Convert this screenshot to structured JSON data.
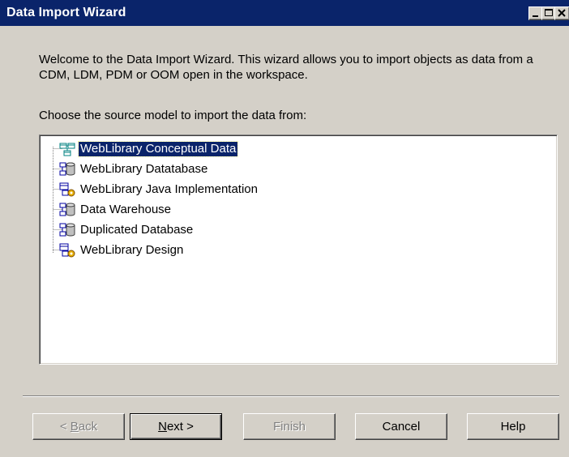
{
  "window": {
    "title": "Data Import Wizard"
  },
  "intro": {
    "text": "Welcome to the Data Import Wizard.  This wizard allows you to import objects as data from a CDM, LDM, PDM or OOM open in the workspace."
  },
  "source": {
    "label": "Choose the source model to import the data from:",
    "models": [
      {
        "label": "WebLibrary Conceptual Data",
        "icon": "cdm-model-icon",
        "selected": true
      },
      {
        "label": "WebLibrary Datatabase",
        "icon": "pdm-model-icon",
        "selected": false
      },
      {
        "label": "WebLibrary Java Implementation",
        "icon": "oom-model-icon",
        "selected": false
      },
      {
        "label": "Data Warehouse",
        "icon": "pdm-model-icon",
        "selected": false
      },
      {
        "label": "Duplicated Database",
        "icon": "pdm-model-icon",
        "selected": false
      },
      {
        "label": "WebLibrary Design",
        "icon": "oom-model-icon",
        "selected": false
      }
    ]
  },
  "buttons": {
    "back": {
      "pre": "< ",
      "accel": "B",
      "post": "ack",
      "enabled": false
    },
    "next": {
      "pre": "",
      "accel": "N",
      "post": "ext >",
      "enabled": true
    },
    "finish": {
      "label": "Finish",
      "enabled": false
    },
    "cancel": {
      "label": "Cancel",
      "enabled": true
    },
    "help": {
      "label": "Help",
      "enabled": true
    }
  },
  "colors": {
    "title_bar": "#0a246a",
    "dialog_face": "#d4d0c8",
    "selection": "#0a246a"
  }
}
